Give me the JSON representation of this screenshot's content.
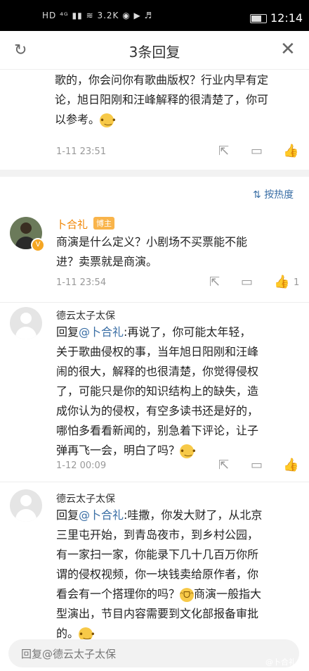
{
  "status": {
    "left_icons": "HD ⁴ᴳ ▮▮ ≋ 3.2K ◉ ▶ ♬",
    "time": "12:14"
  },
  "header": {
    "title": "3条回复"
  },
  "top_comment": {
    "lines": [
      "歌的，你会问你有歌曲版权？行业内早有定",
      "论，旭日阳刚和汪峰解释的很清楚了，你可",
      "以参考。"
    ],
    "emoji": "😏",
    "time": "1-11 23:51"
  },
  "sort_label": "按热度",
  "main_comment": {
    "name": "卜合礼",
    "tag": "博主",
    "lines": [
      "商演是什么定义？小剧场不买票能不能",
      "进？卖票就是商演。"
    ],
    "time": "1-11 23:54",
    "likes": "1"
  },
  "reply1": {
    "name": "德云太子太保",
    "prefix": "回复",
    "mention": "@卜合礼",
    "first_line_rest": ":再说了，你可能太年轻，",
    "lines": [
      "关于歌曲侵权的事，当年旭日阳刚和汪峰",
      "闹的很大，解释的也很清楚，你觉得侵权",
      "了，可能只是你的知识结构上的缺失，造",
      "成你认为的侵权，有空多读书还是好的，",
      "哪怕多看看新闻的，别急着下评论，让子"
    ],
    "last_line": "弹再飞一会，明白了吗？",
    "emoji": "😏",
    "time": "1-12 00:09"
  },
  "reply2": {
    "name": "德云太子太保",
    "prefix": "回复",
    "mention": "@卜合礼",
    "first_line_rest": ":哇撒，你发大财了，从北京",
    "lines": [
      "三里屯开始，到青岛夜市，到乡村公园，",
      "有一家扫一家，你能录下几十几百万你所",
      "谓的侵权视频，你一块钱卖给原作者，你"
    ],
    "line5_a": "看会有一个搭理你的吗？",
    "line5_emoji": "😂",
    "line5_b": "商演一般指大",
    "line6": "型演出，节目内容需要到文化部报备审批",
    "last_line": "的。",
    "emoji": "😏"
  },
  "reply_input": {
    "placeholder": "回复@德云太子太保"
  },
  "watermark": "@卜合礼"
}
